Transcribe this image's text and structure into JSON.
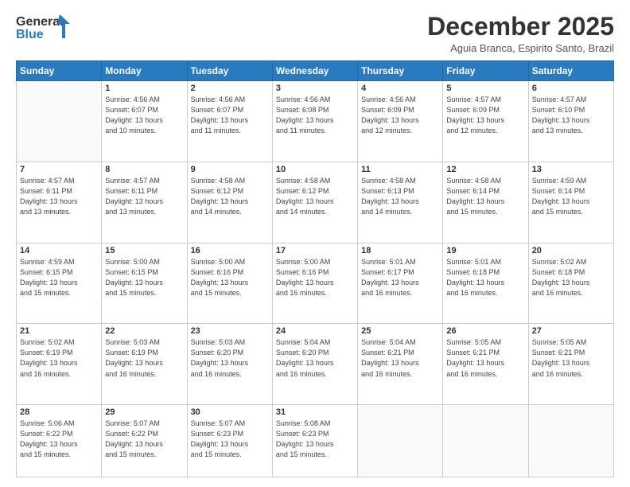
{
  "logo": {
    "line1": "General",
    "line2": "Blue"
  },
  "title": "December 2025",
  "location": "Aguia Branca, Espirito Santo, Brazil",
  "days_header": [
    "Sunday",
    "Monday",
    "Tuesday",
    "Wednesday",
    "Thursday",
    "Friday",
    "Saturday"
  ],
  "weeks": [
    [
      {
        "day": "",
        "info": ""
      },
      {
        "day": "1",
        "info": "Sunrise: 4:56 AM\nSunset: 6:07 PM\nDaylight: 13 hours\nand 10 minutes."
      },
      {
        "day": "2",
        "info": "Sunrise: 4:56 AM\nSunset: 6:07 PM\nDaylight: 13 hours\nand 11 minutes."
      },
      {
        "day": "3",
        "info": "Sunrise: 4:56 AM\nSunset: 6:08 PM\nDaylight: 13 hours\nand 11 minutes."
      },
      {
        "day": "4",
        "info": "Sunrise: 4:56 AM\nSunset: 6:09 PM\nDaylight: 13 hours\nand 12 minutes."
      },
      {
        "day": "5",
        "info": "Sunrise: 4:57 AM\nSunset: 6:09 PM\nDaylight: 13 hours\nand 12 minutes."
      },
      {
        "day": "6",
        "info": "Sunrise: 4:57 AM\nSunset: 6:10 PM\nDaylight: 13 hours\nand 13 minutes."
      }
    ],
    [
      {
        "day": "7",
        "info": "Sunrise: 4:57 AM\nSunset: 6:11 PM\nDaylight: 13 hours\nand 13 minutes."
      },
      {
        "day": "8",
        "info": "Sunrise: 4:57 AM\nSunset: 6:11 PM\nDaylight: 13 hours\nand 13 minutes."
      },
      {
        "day": "9",
        "info": "Sunrise: 4:58 AM\nSunset: 6:12 PM\nDaylight: 13 hours\nand 14 minutes."
      },
      {
        "day": "10",
        "info": "Sunrise: 4:58 AM\nSunset: 6:12 PM\nDaylight: 13 hours\nand 14 minutes."
      },
      {
        "day": "11",
        "info": "Sunrise: 4:58 AM\nSunset: 6:13 PM\nDaylight: 13 hours\nand 14 minutes."
      },
      {
        "day": "12",
        "info": "Sunrise: 4:58 AM\nSunset: 6:14 PM\nDaylight: 13 hours\nand 15 minutes."
      },
      {
        "day": "13",
        "info": "Sunrise: 4:59 AM\nSunset: 6:14 PM\nDaylight: 13 hours\nand 15 minutes."
      }
    ],
    [
      {
        "day": "14",
        "info": "Sunrise: 4:59 AM\nSunset: 6:15 PM\nDaylight: 13 hours\nand 15 minutes."
      },
      {
        "day": "15",
        "info": "Sunrise: 5:00 AM\nSunset: 6:15 PM\nDaylight: 13 hours\nand 15 minutes."
      },
      {
        "day": "16",
        "info": "Sunrise: 5:00 AM\nSunset: 6:16 PM\nDaylight: 13 hours\nand 15 minutes."
      },
      {
        "day": "17",
        "info": "Sunrise: 5:00 AM\nSunset: 6:16 PM\nDaylight: 13 hours\nand 16 minutes."
      },
      {
        "day": "18",
        "info": "Sunrise: 5:01 AM\nSunset: 6:17 PM\nDaylight: 13 hours\nand 16 minutes."
      },
      {
        "day": "19",
        "info": "Sunrise: 5:01 AM\nSunset: 6:18 PM\nDaylight: 13 hours\nand 16 minutes."
      },
      {
        "day": "20",
        "info": "Sunrise: 5:02 AM\nSunset: 6:18 PM\nDaylight: 13 hours\nand 16 minutes."
      }
    ],
    [
      {
        "day": "21",
        "info": "Sunrise: 5:02 AM\nSunset: 6:19 PM\nDaylight: 13 hours\nand 16 minutes."
      },
      {
        "day": "22",
        "info": "Sunrise: 5:03 AM\nSunset: 6:19 PM\nDaylight: 13 hours\nand 16 minutes."
      },
      {
        "day": "23",
        "info": "Sunrise: 5:03 AM\nSunset: 6:20 PM\nDaylight: 13 hours\nand 16 minutes."
      },
      {
        "day": "24",
        "info": "Sunrise: 5:04 AM\nSunset: 6:20 PM\nDaylight: 13 hours\nand 16 minutes."
      },
      {
        "day": "25",
        "info": "Sunrise: 5:04 AM\nSunset: 6:21 PM\nDaylight: 13 hours\nand 16 minutes."
      },
      {
        "day": "26",
        "info": "Sunrise: 5:05 AM\nSunset: 6:21 PM\nDaylight: 13 hours\nand 16 minutes."
      },
      {
        "day": "27",
        "info": "Sunrise: 5:05 AM\nSunset: 6:21 PM\nDaylight: 13 hours\nand 16 minutes."
      }
    ],
    [
      {
        "day": "28",
        "info": "Sunrise: 5:06 AM\nSunset: 6:22 PM\nDaylight: 13 hours\nand 15 minutes."
      },
      {
        "day": "29",
        "info": "Sunrise: 5:07 AM\nSunset: 6:22 PM\nDaylight: 13 hours\nand 15 minutes."
      },
      {
        "day": "30",
        "info": "Sunrise: 5:07 AM\nSunset: 6:23 PM\nDaylight: 13 hours\nand 15 minutes."
      },
      {
        "day": "31",
        "info": "Sunrise: 5:08 AM\nSunset: 6:23 PM\nDaylight: 13 hours\nand 15 minutes."
      },
      {
        "day": "",
        "info": ""
      },
      {
        "day": "",
        "info": ""
      },
      {
        "day": "",
        "info": ""
      }
    ]
  ]
}
